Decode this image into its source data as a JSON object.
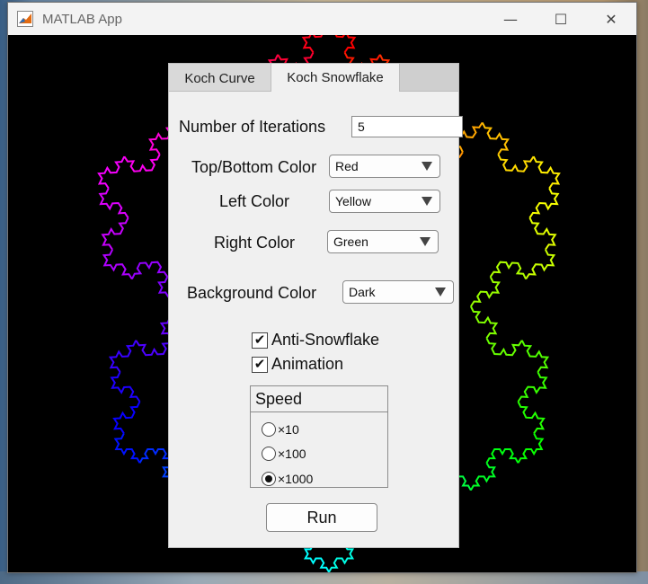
{
  "window": {
    "title": "MATLAB App",
    "minimize_glyph": "—",
    "maximize_glyph": "☐",
    "close_glyph": "✕",
    "icon": "matlab-icon"
  },
  "tabs": [
    {
      "label": "Koch Curve",
      "active": false
    },
    {
      "label": "Koch Snowflake",
      "active": true
    }
  ],
  "form": {
    "iterations_label": "Number of Iterations",
    "iterations_value": "5",
    "top_bottom_label": "Top/Bottom Color",
    "top_bottom_value": "Red",
    "left_label": "Left Color",
    "left_value": "Yellow",
    "right_label": "Right Color",
    "right_value": "Green",
    "background_label": "Background Color",
    "background_value": "Dark",
    "anti_snowflake_label": "Anti-Snowflake",
    "anti_snowflake_checked": true,
    "animation_label": "Animation",
    "animation_checked": true,
    "check_glyph": "✔"
  },
  "speed": {
    "title": "Speed",
    "options": [
      {
        "label": "×10",
        "selected": false
      },
      {
        "label": "×100",
        "selected": false
      },
      {
        "label": "×1000",
        "selected": true
      }
    ]
  },
  "run_label": "Run",
  "colors": {
    "canvas_background": "#000000",
    "panel_background": "#f0f0f0",
    "titlebar": "#f3f3f3"
  }
}
